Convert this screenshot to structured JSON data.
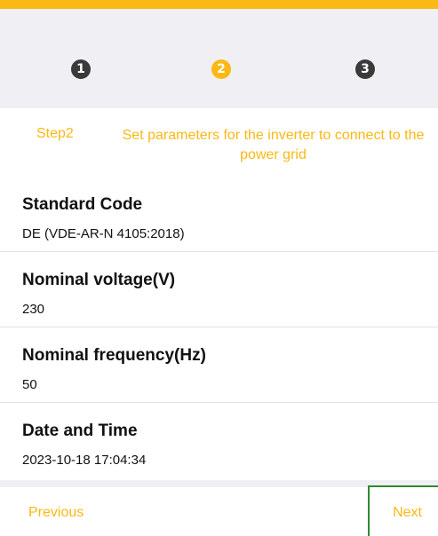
{
  "colors": {
    "accent": "#fcb814",
    "step_inactive": "#3a3a3a",
    "header_bg": "#efeff4"
  },
  "stepper": {
    "steps": [
      {
        "label": "1",
        "state": "done"
      },
      {
        "label": "2",
        "state": "active"
      },
      {
        "label": "3",
        "state": "pending"
      }
    ]
  },
  "step_description": {
    "step": "Step2",
    "text": "Set parameters for the inverter to connect to the power grid"
  },
  "fields": [
    {
      "title": "Standard Code",
      "value": "DE (VDE-AR-N 4105:2018)"
    },
    {
      "title": "Nominal voltage(V)",
      "value": "230"
    },
    {
      "title": "Nominal frequency(Hz)",
      "value": "50"
    },
    {
      "title": "Date and Time",
      "value": "2023-10-18 17:04:34"
    }
  ],
  "footer": {
    "previous_label": "Previous",
    "next_label": "Next"
  }
}
